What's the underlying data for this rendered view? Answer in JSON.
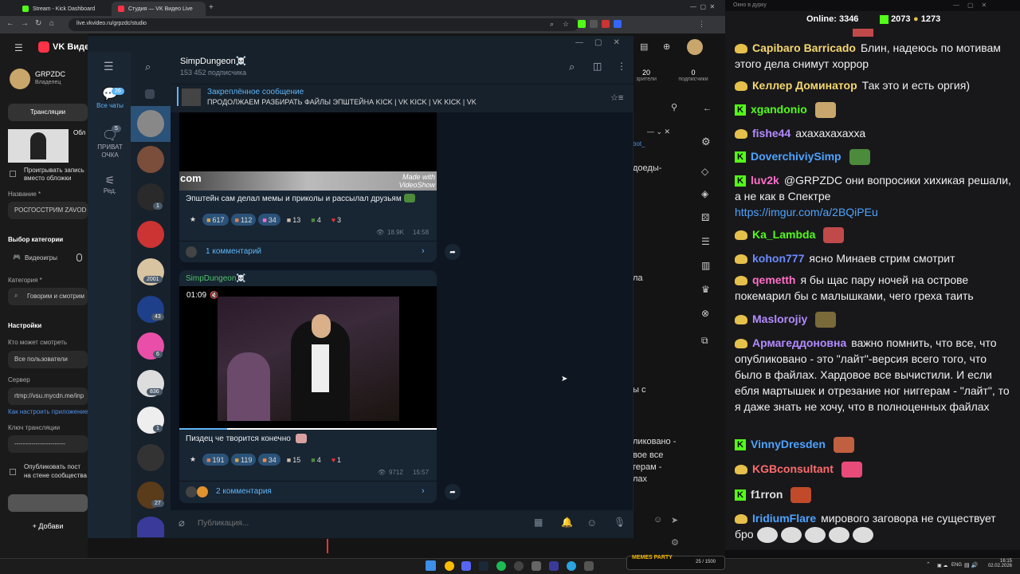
{
  "browser": {
    "tabs": [
      {
        "label": "Stream - Kick Dashboard",
        "active": false
      },
      {
        "label": "Студия — VK Видео Live",
        "active": true
      }
    ],
    "url": "live.vkvideo.ru/grpzdc/studio"
  },
  "vk": {
    "logo": "VK Видео",
    "channel_name": "GRPZDC",
    "channel_role": "Владелец",
    "tab_broadcasts": "Трансляции",
    "cover_checkbox_label": "Проигрывать запись вместо обложки",
    "name_label": "Название *",
    "name_value": "РОСГОССТРИМ ZAVOD",
    "category_title": "Выбор категории",
    "category_type": "Видеоигры",
    "category_label": "Категория *",
    "category_value": "Говорим и смотрим",
    "settings_title": "Настройки",
    "who_can_watch_label": "Кто может смотреть",
    "who_can_watch_value": "Все пользователи",
    "server_label": "Сервер",
    "server_value": "rtmp://vsu.mycdn.me/inp",
    "configure_link": "Как настроить приложение",
    "key_label": "Ключ трансляции",
    "key_value": "------------------------",
    "publish_label": "Опубликовать пост на стене сообщества",
    "add_button": "Добави",
    "stats": [
      {
        "value": "20",
        "label": "зрители"
      },
      {
        "value": "0",
        "label": "подписчики"
      }
    ]
  },
  "telegram": {
    "channel_title": "SimpDungeon☠️",
    "subscribers": "153 452 подписчика",
    "sidebar": {
      "all_chats_label": "Все чаты",
      "all_chats_count": "26",
      "private_label": "ПРИВАТ ОЧКА",
      "private_count": "5",
      "edit_label": "Ред."
    },
    "chat_badges": [
      "1",
      "2001",
      "43",
      "6",
      "836",
      "1",
      "27"
    ],
    "pinned": {
      "title": "Закреплённое сообщение",
      "text": "ПРОДОЛЖАЕМ РАЗБИРАТЬ ФАЙЛЫ ЭПШТЕЙНА  KICK | VK KICK | VK KICK | VK"
    },
    "messages": [
      {
        "watermark": "Made with VideoShow",
        "text": "Эпштейн сам делал мемы и приколы и рассылал друзьям",
        "reactions": [
          "617",
          "112",
          "34",
          "13",
          "4",
          "3"
        ],
        "views": "18.9K",
        "time": "14:58",
        "comments": "1 комментарий"
      },
      {
        "author": "SimpDungeon☠️",
        "video_time": "01:09",
        "text": "Пиздец че творится конечно",
        "reactions": [
          "191",
          "119",
          "34",
          "15",
          "4",
          "1"
        ],
        "views": "9712",
        "time": "15:57",
        "comments": "2 комментария"
      }
    ],
    "compose_placeholder": "Публикация..."
  },
  "behind_text": {
    "fragments": [
      "bot_",
      "доеды-",
      "ла",
      "ы с",
      "ликовано -",
      "вое все",
      "герам -",
      "лах"
    ]
  },
  "chat": {
    "title": "Окно в дурку",
    "online_label": "Online:",
    "online_value": "3346",
    "stat_a": "2073",
    "stat_b": "1273",
    "messages": [
      {
        "user": "Capibaro Barricado",
        "color": "#f5d76e",
        "text": "Блин, надеюсь по мотивам этого дела снимут хоррор",
        "badge": "pepe"
      },
      {
        "user": "Келлер Доминатор",
        "color": "#f5d76e",
        "text": "Так это и есть оргия)",
        "badge": "pepe"
      },
      {
        "user": "xgandonio",
        "color": "#53fc18",
        "text": "",
        "badge": "kick"
      },
      {
        "user": "fishe44",
        "color": "#b38bff",
        "text": "ахахахахахха",
        "badge": "pepe"
      },
      {
        "user": "DoverchiviySimp",
        "color": "#4da3ff",
        "text": "",
        "badge": "kick"
      },
      {
        "user": "luv2k",
        "color": "#ff6ec7",
        "text": "@GRPZDC они вопросики хихикая решали, а не как в Спектре",
        "badge": "kick"
      },
      {
        "user": "",
        "color": "#4da3ff",
        "text": "https://imgur.com/a/2BQiPEu",
        "badge": ""
      },
      {
        "user": "Ka_Lambda",
        "color": "#53fc18",
        "text": "",
        "badge": "pepe"
      },
      {
        "user": "kohon777",
        "color": "#6b8cff",
        "text": "ясно Минаев стрим смотрит",
        "badge": "pepe"
      },
      {
        "user": "qemetth",
        "color": "#ff6ec7",
        "text": "я бы щас пару ночей на острове покемарил бы с малышками, чего греха таить",
        "badge": "pepe"
      },
      {
        "user": "Maslorojiy",
        "color": "#b38bff",
        "text": "",
        "badge": "pepe"
      },
      {
        "user": "Армагеддоновна",
        "color": "#b38bff",
        "text": "важно помнить, что все, что опубликовано - это \"лайт\"-версия всего того, что было в файлах. Хардовое все вычистили. И если ебля мартышек и отрезание ног ниггерам - \"лайт\", то я даже знать не хочу, что в полноценных файлах",
        "badge": "pepe"
      },
      {
        "user": "VinnyDresden",
        "color": "#4da3ff",
        "text": "",
        "badge": "kick"
      },
      {
        "user": "KGBconsultant",
        "color": "#ff6b6b",
        "text": "",
        "badge": "pepe"
      },
      {
        "user": "f1rron",
        "color": "#ddd",
        "text": "",
        "badge": "kick"
      },
      {
        "user": "IridiumFlare",
        "color": "#4da3ff",
        "text": "мирового заговора не существует бро",
        "badge": "pepe"
      }
    ]
  },
  "taskbar": {
    "widget_text": "MEMES PARTY",
    "widget_count": "25 / 1500",
    "lang": "ENG",
    "time": "16:15",
    "date": "02.02.2026"
  }
}
